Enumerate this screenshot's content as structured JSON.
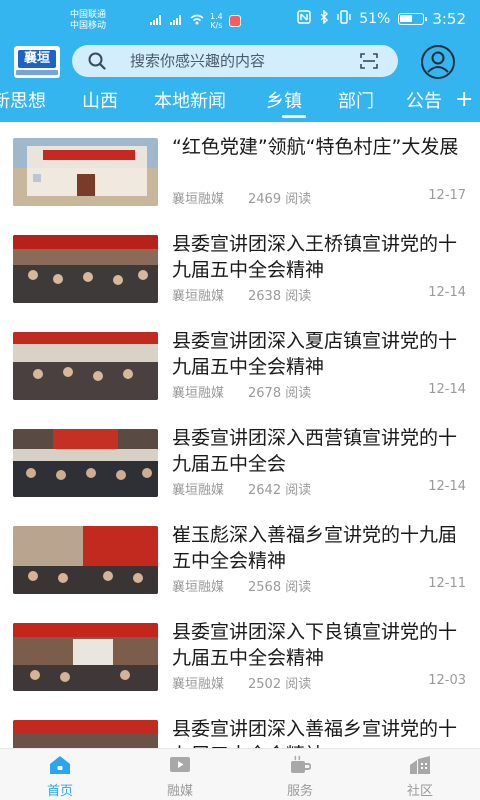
{
  "status_bar": {
    "carrier_1": "中国联通",
    "carrier_2": "中国移动",
    "speed_value": "1.4",
    "speed_unit": "K/s",
    "battery": "51%",
    "time": "3:52"
  },
  "search": {
    "placeholder": "搜索你感兴趣的内容"
  },
  "logo": {
    "text": "襄垣"
  },
  "tabs": [
    {
      "label": "新思想"
    },
    {
      "label": "山西"
    },
    {
      "label": "本地新闻"
    },
    {
      "label": "乡镇"
    },
    {
      "label": "部门"
    },
    {
      "label": "公告"
    }
  ],
  "active_tab": "乡镇",
  "add_tab_label": "+",
  "articles": [
    {
      "title": "“红色党建”领航“特色村庄”大发展",
      "source": "襄垣融媒",
      "reads": "2469 阅读",
      "date": "12-17"
    },
    {
      "title": "县委宣讲团深入王桥镇宣讲党的十九届五中全会精神",
      "source": "襄垣融媒",
      "reads": "2638 阅读",
      "date": "12-14"
    },
    {
      "title": "县委宣讲团深入夏店镇宣讲党的十九届五中全会精神",
      "source": "襄垣融媒",
      "reads": "2678 阅读",
      "date": "12-14"
    },
    {
      "title": "县委宣讲团深入西营镇宣讲党的十九届五中全会",
      "source": "襄垣融媒",
      "reads": "2642 阅读",
      "date": "12-14"
    },
    {
      "title": "崔玉彪深入善福乡宣讲党的十九届五中全会精神",
      "source": "襄垣融媒",
      "reads": "2568 阅读",
      "date": "12-11"
    },
    {
      "title": "县委宣讲团深入下良镇宣讲党的十九届五中全会精神",
      "source": "襄垣融媒",
      "reads": "2502 阅读",
      "date": "12-03"
    },
    {
      "title": "县委宣讲团深入善福乡宣讲党的十九届五中全会精神",
      "source": "",
      "reads": "",
      "date": ""
    }
  ],
  "bottom_nav": [
    {
      "label": "首页",
      "icon": "home-icon"
    },
    {
      "label": "融媒",
      "icon": "video-icon"
    },
    {
      "label": "服务",
      "icon": "service-icon"
    },
    {
      "label": "社区",
      "icon": "community-icon"
    }
  ],
  "colors": {
    "accent": "#34b5f0",
    "active_nav": "#2aa6ea",
    "text_primary": "#1a1a1a",
    "text_secondary": "#9a9a9a"
  }
}
